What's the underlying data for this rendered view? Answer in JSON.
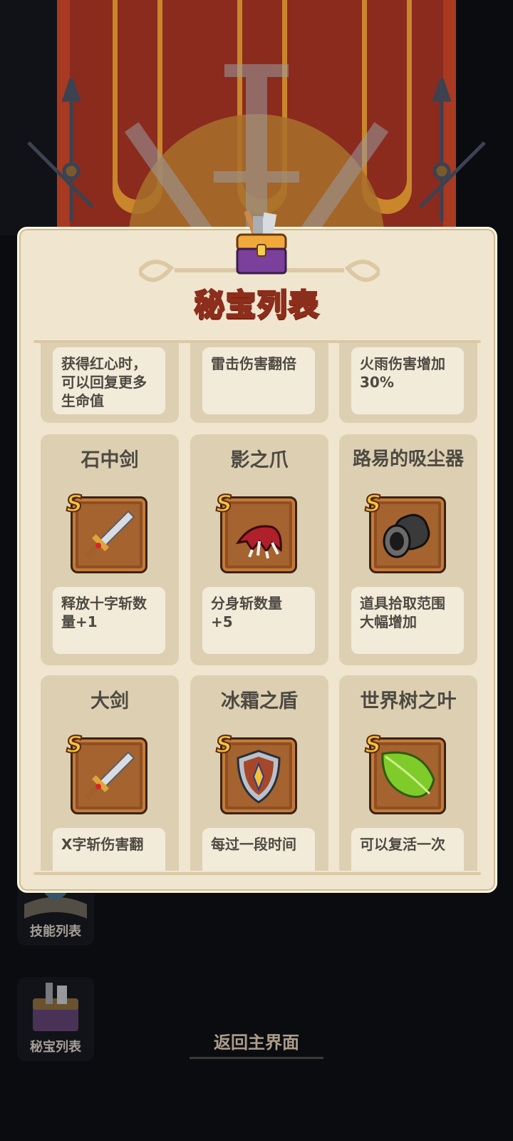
{
  "panel": {
    "title": "秘宝列表"
  },
  "top_descriptions": [
    {
      "text": "获得红心时，\n可以回复更多\n生命值"
    },
    {
      "text": "雷击伤害翻倍"
    },
    {
      "text": "火雨伤害增加\n30%"
    }
  ],
  "treasures": [
    {
      "name": "石中剑",
      "rank": "S",
      "icon": "sword-icon",
      "description": "释放十字斩数\n量+1"
    },
    {
      "name": "影之爪",
      "rank": "S",
      "icon": "claw-icon",
      "description": "分身斩数量\n+5"
    },
    {
      "name": "路易的吸尘器",
      "rank": "S",
      "icon": "vacuum-icon",
      "description": "道具拾取范围\n大幅增加"
    },
    {
      "name": "大剑",
      "rank": "S",
      "icon": "sword-icon",
      "description": "X字斩伤害翻"
    },
    {
      "name": "冰霜之盾",
      "rank": "S",
      "icon": "shield-icon",
      "description": "每过一段时间"
    },
    {
      "name": "世界树之叶",
      "rank": "S",
      "icon": "leaf-icon",
      "description": "可以复活一次"
    }
  ],
  "side_buttons": [
    {
      "label": "技能列表",
      "icon": "spellbook-icon"
    },
    {
      "label": "秘宝列表",
      "icon": "treasure-chest-icon"
    }
  ],
  "back_button": {
    "label": "返回主界面"
  }
}
